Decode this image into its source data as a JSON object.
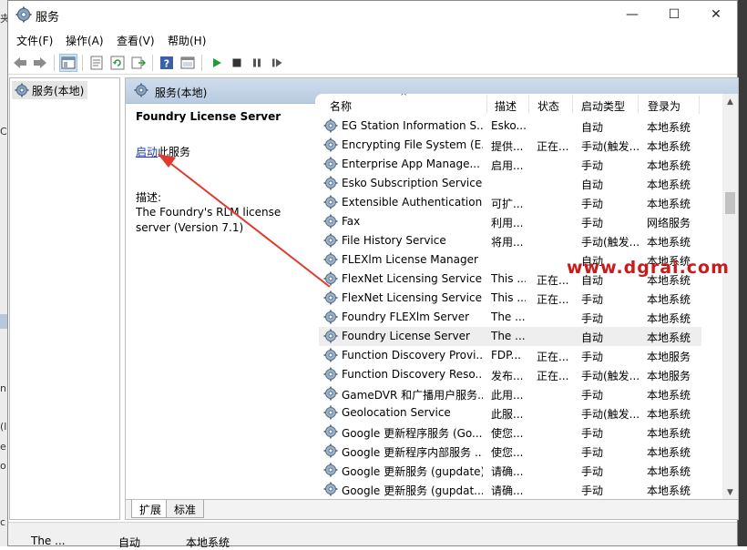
{
  "window": {
    "title": "服务",
    "controls": [
      "—",
      "☐",
      "✕"
    ]
  },
  "menu": [
    "文件(F)",
    "操作(A)",
    "查看(V)",
    "帮助(H)"
  ],
  "tree": {
    "item": "服务(本地)"
  },
  "content": {
    "header": "服务(本地)"
  },
  "details": {
    "service_name": "Foundry License Server",
    "start_link": "启动",
    "start_suffix": "此服务",
    "desc_label": "描述:",
    "desc_text": "The Foundry's RLM license server (Version 7.1)"
  },
  "columns": [
    "名称",
    "描述",
    "状态",
    "启动类型",
    "登录为"
  ],
  "rows": [
    {
      "name": "EG Station Information S...",
      "desc": "Esko...",
      "status": "",
      "start": "自动",
      "logon": "本地系统"
    },
    {
      "name": "Encrypting File System (E...",
      "desc": "提供...",
      "status": "正在...",
      "start": "手动(触发...",
      "logon": "本地系统"
    },
    {
      "name": "Enterprise App Manage...",
      "desc": "启用...",
      "status": "",
      "start": "手动",
      "logon": "本地系统"
    },
    {
      "name": "Esko Subscription Service",
      "desc": "",
      "status": "",
      "start": "自动",
      "logon": "本地系统"
    },
    {
      "name": "Extensible Authentication...",
      "desc": "可扩...",
      "status": "",
      "start": "手动",
      "logon": "本地系统"
    },
    {
      "name": "Fax",
      "desc": "利用...",
      "status": "",
      "start": "手动",
      "logon": "网络服务"
    },
    {
      "name": "File History Service",
      "desc": "将用...",
      "status": "",
      "start": "手动(触发...",
      "logon": "本地系统"
    },
    {
      "name": "FLEXlm License Manager",
      "desc": "",
      "status": "",
      "start": "自动",
      "logon": "本地系统"
    },
    {
      "name": "FlexNet Licensing Service",
      "desc": "This ...",
      "status": "正在...",
      "start": "自动",
      "logon": "本地系统"
    },
    {
      "name": "FlexNet Licensing Service...",
      "desc": "This ...",
      "status": "正在...",
      "start": "手动",
      "logon": "本地系统"
    },
    {
      "name": "Foundry FLEXlm Server",
      "desc": "The ...",
      "status": "",
      "start": "手动",
      "logon": "本地系统"
    },
    {
      "name": "Foundry License Server",
      "desc": "The ...",
      "status": "",
      "start": "自动",
      "logon": "本地系统"
    },
    {
      "name": "Function Discovery Provi...",
      "desc": "FDP...",
      "status": "正在...",
      "start": "手动",
      "logon": "本地服务"
    },
    {
      "name": "Function Discovery Reso...",
      "desc": "发布...",
      "status": "正在...",
      "start": "手动(触发...",
      "logon": "本地服务"
    },
    {
      "name": "GameDVR 和广播用户服务...",
      "desc": "此用...",
      "status": "",
      "start": "手动",
      "logon": "本地系统"
    },
    {
      "name": "Geolocation Service",
      "desc": "此服...",
      "status": "",
      "start": "手动(触发...",
      "logon": "本地系统"
    },
    {
      "name": "Google 更新程序服务 (Go...",
      "desc": "使您...",
      "status": "",
      "start": "手动",
      "logon": "本地系统"
    },
    {
      "name": "Google 更新程序内部服务 ...",
      "desc": "使您...",
      "status": "",
      "start": "手动",
      "logon": "本地系统"
    },
    {
      "name": "Google 更新服务 (gupdate)",
      "desc": "请确...",
      "status": "",
      "start": "手动",
      "logon": "本地系统"
    },
    {
      "name": "Google 更新服务 (gupdat...",
      "desc": "请确...",
      "status": "",
      "start": "手动",
      "logon": "本地系统"
    }
  ],
  "tabs": [
    "扩展",
    "标准"
  ],
  "status_below": [
    "The ...",
    "自动",
    "本地系统"
  ],
  "watermark": "www.dgrai.com",
  "colors": {
    "header_blue": "#c2d3e8",
    "link": "#1a35b5",
    "watermark": "#cc1a1a",
    "arrow": "#e03a2f"
  },
  "icons": [
    "services-gear-icon",
    "back-icon",
    "forward-icon",
    "console-tree-icon",
    "properties-icon",
    "refresh-icon",
    "export-icon",
    "help-icon",
    "console-icon",
    "play-icon",
    "stop-icon",
    "pause-icon",
    "restart-icon"
  ]
}
